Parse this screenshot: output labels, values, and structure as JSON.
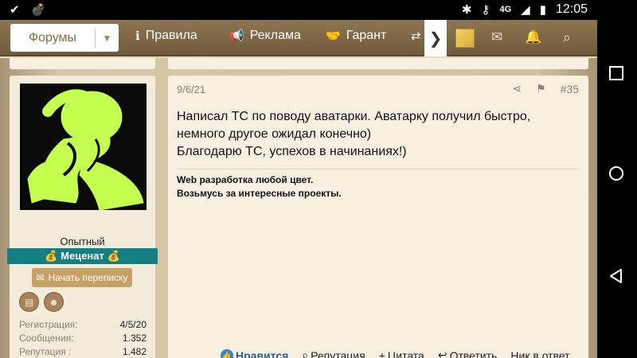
{
  "statusbar": {
    "left_icons": [
      "check-icon",
      "bomb-icon"
    ],
    "network": "4G",
    "time": "12:05"
  },
  "nav": {
    "forum_label": "Форумы",
    "items": [
      {
        "label": "Правила",
        "icon": "info-icon"
      },
      {
        "label": "Реклама",
        "icon": "megaphone-icon"
      },
      {
        "label": "Гарант",
        "icon": "handshake-icon"
      }
    ]
  },
  "user": {
    "rank": "Опытный",
    "badge": "💰 Меценат 💰",
    "message_button": "Начать переписку",
    "stats": [
      {
        "key": "Регистрация:",
        "value": "4/5/20"
      },
      {
        "key": "Сообщения:",
        "value": "1.352"
      },
      {
        "key": "Репутация :",
        "value": "1.482"
      }
    ]
  },
  "post": {
    "date": "9/6/21",
    "number": "#35",
    "text_lines": [
      "Написал ТС по поводу аватарки. Аватарку получил быстро,",
      "немного другое ожидал конечно)",
      "Благодарю ТС, успехов в начинаниях!)"
    ],
    "signature_lines": [
      "Web разработка любой цвет.",
      "Возьмусь за интересные проекты."
    ],
    "actions": {
      "like": "Нравится",
      "reputation": "Репутация",
      "quote": "Цитата",
      "reply": "Ответить",
      "nick": "Ник в ответ"
    }
  },
  "colors": {
    "nav_bg": "#7f6847",
    "badge_bg": "#157e82",
    "button_bg": "#c6a064",
    "avatar_scribble": "#c4ff4f"
  }
}
